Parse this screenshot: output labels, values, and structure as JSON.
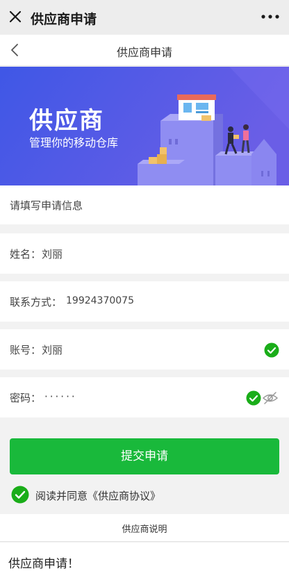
{
  "window": {
    "title": "供应商申请"
  },
  "nav": {
    "title": "供应商申请"
  },
  "banner": {
    "title": "供应商",
    "subtitle": "管理你的移动仓库"
  },
  "form": {
    "hint": "请填写申请信息",
    "name": {
      "label": "姓名：",
      "value": "刘丽"
    },
    "phone": {
      "label": "联系方式：",
      "value": "19924370075"
    },
    "account": {
      "label": "账号：",
      "value": "刘丽"
    },
    "password": {
      "label": "密码：",
      "value": "······"
    }
  },
  "submit_label": "提交申请",
  "agreement": {
    "text": "阅读并同意《供应商协议》",
    "checked": true
  },
  "description": {
    "header": "供应商说明",
    "body": "供应商申请！"
  },
  "colors": {
    "accent": "#19b93b",
    "banner_start": "#3f57e6",
    "banner_end": "#6a5ee6",
    "check": "#1aad19"
  },
  "icons": [
    "close-icon",
    "more-icon",
    "back-icon",
    "check-circle-icon",
    "eye-off-icon"
  ]
}
